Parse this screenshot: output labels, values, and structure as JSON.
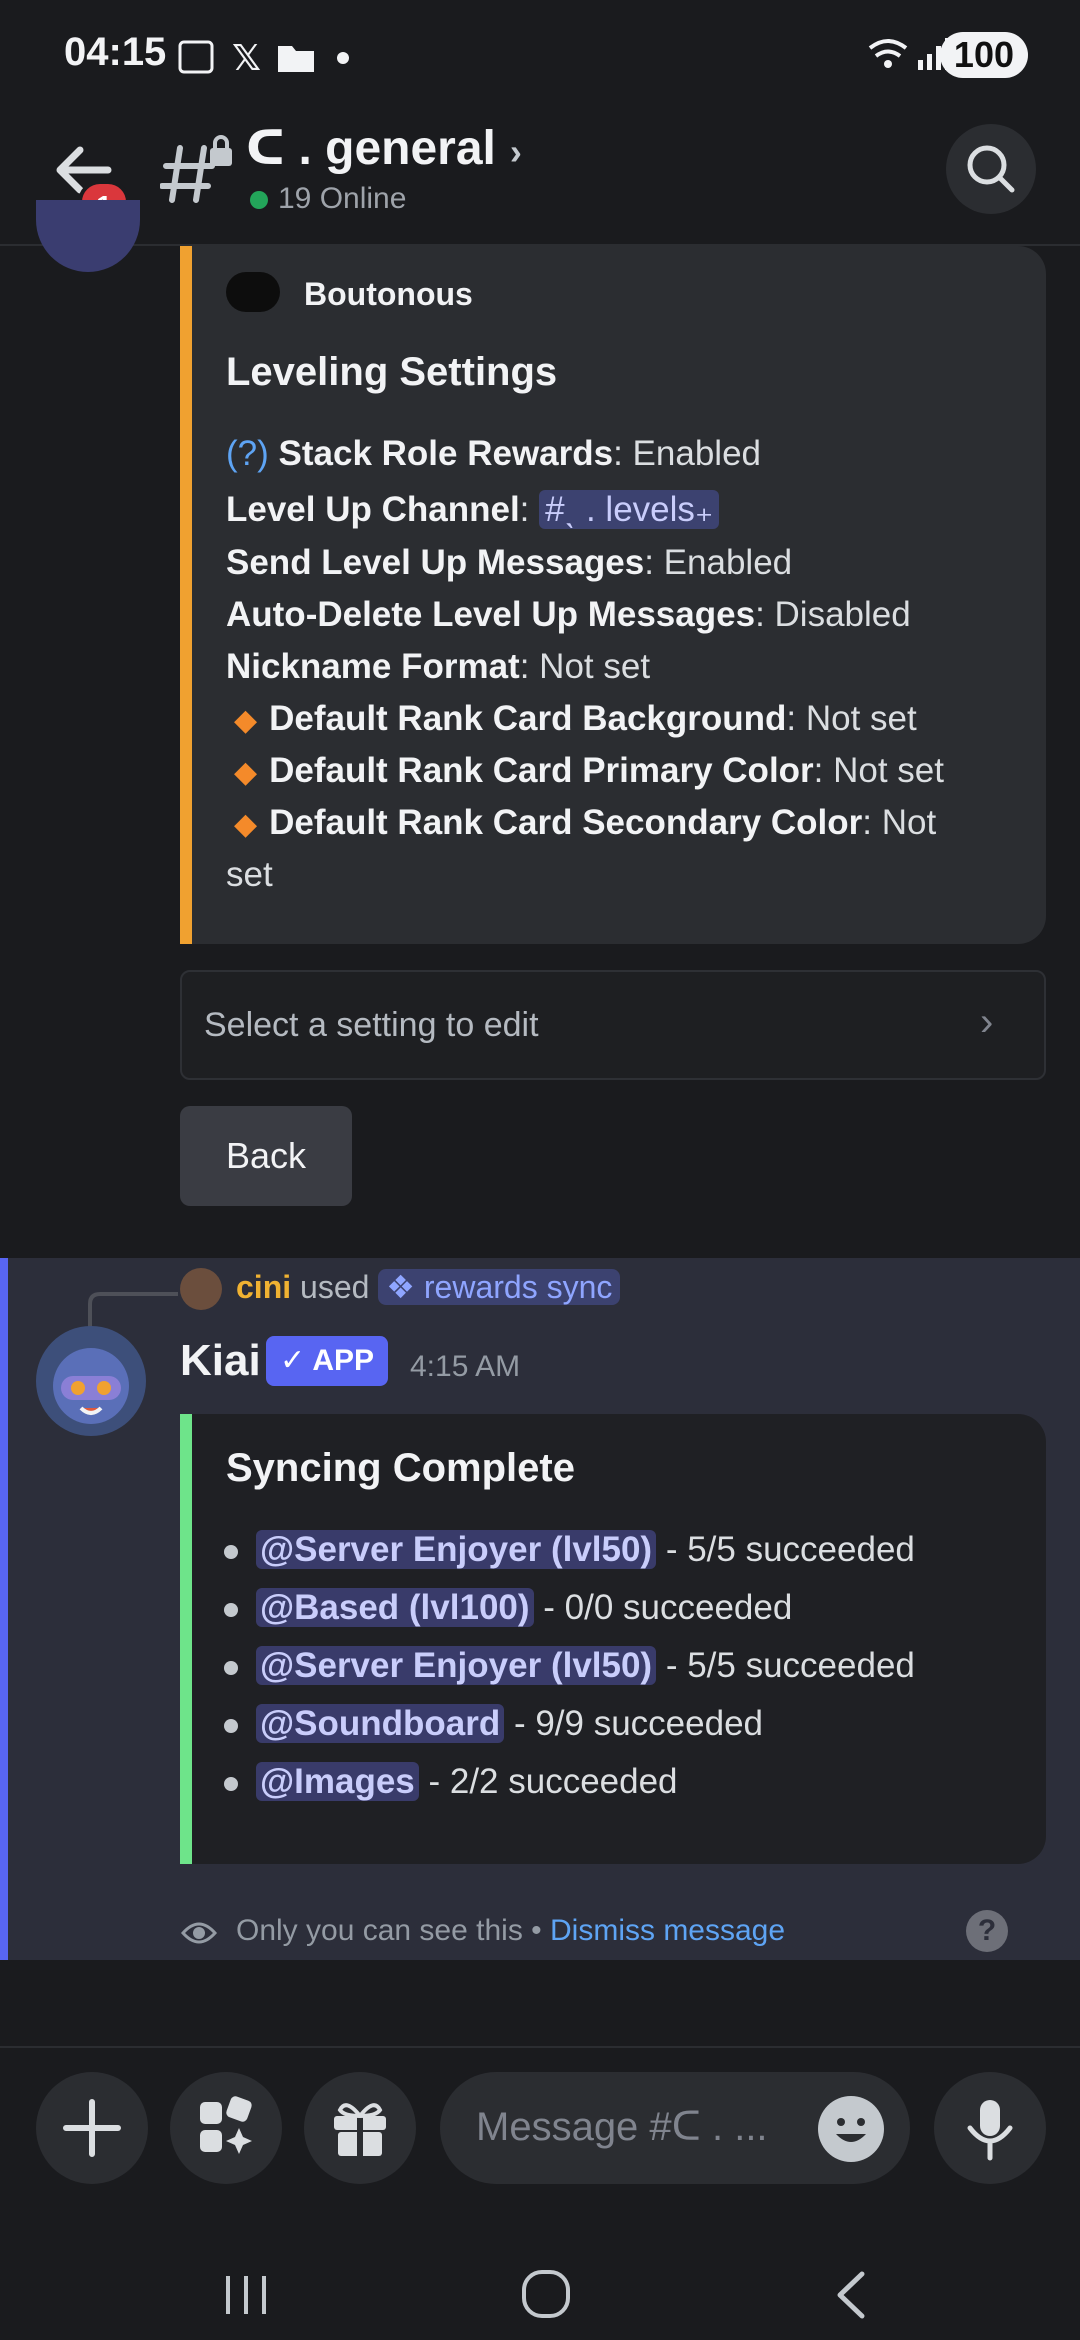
{
  "status_bar": {
    "time": "04:15",
    "battery": "100"
  },
  "header": {
    "back_badge": "1",
    "channel_name": "ᑕ . general",
    "online": "19 Online"
  },
  "leveling_embed": {
    "author": "Boutonous",
    "title": "Leveling Settings",
    "help_marker": "(?)",
    "lines": [
      {
        "label": "Stack Role Rewards",
        "value": ": Enabled"
      },
      {
        "label": "Level Up Channel",
        "value": ": ",
        "channel": "#ˎ . levels₊"
      },
      {
        "label": "Send Level Up Messages",
        "value": ": Enabled"
      },
      {
        "label": "Auto-Delete Level Up Messages",
        "value": ": Disabled"
      },
      {
        "label": "Nickname Format",
        "value": ": Not set"
      },
      {
        "label": "Default Rank Card Background",
        "value": ": Not set"
      },
      {
        "label": "Default Rank Card Primary Color",
        "value": ": Not set"
      },
      {
        "label": "Default Rank Card Secondary Color",
        "value": ": Not",
        "wrap": "set"
      }
    ]
  },
  "select": {
    "placeholder": "Select a setting to edit"
  },
  "back_button": "Back",
  "command": {
    "user": "cini",
    "used": "used",
    "command": "rewards sync"
  },
  "kiai_message": {
    "name": "Kiai",
    "tag": "✓ APP",
    "time": "4:15 AM",
    "title": "Syncing Complete",
    "items": [
      {
        "role": "@Server Enjoyer (lvl50)",
        "result": " - 5/5 succeeded"
      },
      {
        "role": "@Based (lvl100)",
        "result": " - 0/0 succeeded"
      },
      {
        "role": "@Server Enjoyer (lvl50)",
        "result": " - 5/5 succeeded"
      },
      {
        "role": "@Soundboard",
        "result": " - 9/9 succeeded"
      },
      {
        "role": "@Images",
        "result": " - 2/2 succeeded"
      }
    ],
    "only_you": "Only you can see this •",
    "dismiss": "Dismiss message",
    "help": "?"
  },
  "composer": {
    "placeholder": "Message #ᑕ . ..."
  },
  "icons": [
    "back-arrow-icon",
    "search-icon",
    "plus-icon",
    "apps-icon",
    "gift-icon",
    "emoji-icon",
    "mic-icon",
    "eye-icon"
  ],
  "colors": {
    "accent": "#5865f2",
    "embed1_bar": "#f0a130",
    "embed2_bar": "#6ee48a",
    "link": "#5ea4f4"
  }
}
